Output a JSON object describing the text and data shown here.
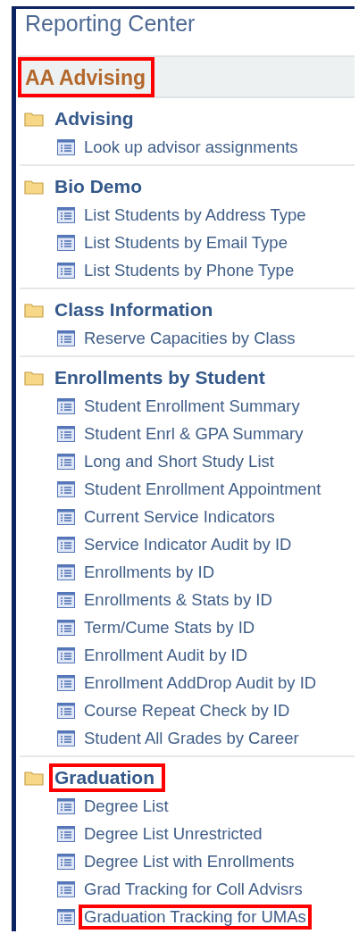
{
  "title": "Reporting Center",
  "section": {
    "label": "AA Advising",
    "highlighted": true
  },
  "folders": [
    {
      "title": "Advising",
      "highlighted": false,
      "items": [
        {
          "label": "Look up advisor assignments",
          "highlighted": false
        }
      ]
    },
    {
      "title": "Bio Demo",
      "highlighted": false,
      "items": [
        {
          "label": "List Students by Address Type",
          "highlighted": false
        },
        {
          "label": "List Students by Email Type",
          "highlighted": false
        },
        {
          "label": "List Students by Phone Type",
          "highlighted": false
        }
      ]
    },
    {
      "title": "Class Information",
      "highlighted": false,
      "items": [
        {
          "label": "Reserve Capacities by Class",
          "highlighted": false
        }
      ]
    },
    {
      "title": "Enrollments by Student",
      "highlighted": false,
      "items": [
        {
          "label": "Student Enrollment Summary",
          "highlighted": false
        },
        {
          "label": "Student Enrl & GPA Summary",
          "highlighted": false
        },
        {
          "label": "Long and Short Study List",
          "highlighted": false
        },
        {
          "label": "Student Enrollment Appointment",
          "highlighted": false
        },
        {
          "label": "Current Service Indicators",
          "highlighted": false
        },
        {
          "label": "Service Indicator Audit by ID",
          "highlighted": false
        },
        {
          "label": "Enrollments by ID",
          "highlighted": false
        },
        {
          "label": "Enrollments & Stats by ID",
          "highlighted": false
        },
        {
          "label": "Term/Cume Stats by ID",
          "highlighted": false
        },
        {
          "label": "Enrollment Audit by ID",
          "highlighted": false
        },
        {
          "label": "Enrollment AddDrop Audit by ID",
          "highlighted": false
        },
        {
          "label": "Course Repeat Check by ID",
          "highlighted": false
        },
        {
          "label": "Student All Grades by Career",
          "highlighted": false
        }
      ]
    },
    {
      "title": "Graduation",
      "highlighted": true,
      "items": [
        {
          "label": "Degree List",
          "highlighted": false
        },
        {
          "label": "Degree List Unrestricted",
          "highlighted": false
        },
        {
          "label": "Degree List with Enrollments",
          "highlighted": false
        },
        {
          "label": "Grad Tracking for Coll Advisrs",
          "highlighted": false
        },
        {
          "label": "Graduation Tracking for UMAs",
          "highlighted": true
        }
      ]
    }
  ]
}
